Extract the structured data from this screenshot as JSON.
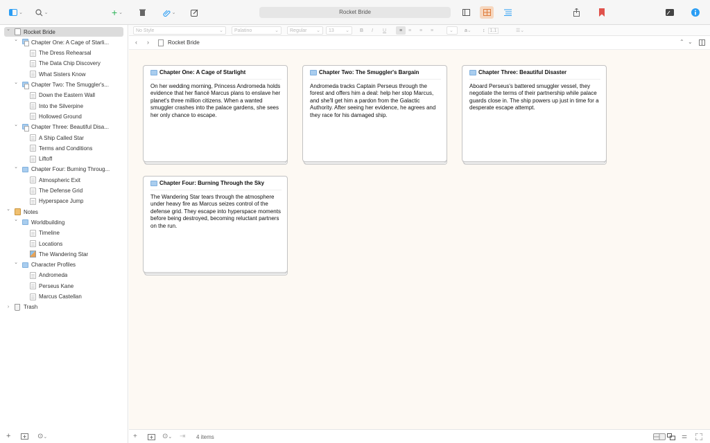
{
  "window": {
    "title": "Rocket Bride"
  },
  "toolbar": {
    "colors": {
      "accent": "#2a9df4",
      "bookmark": "#e0524c",
      "corkboard_active": "#f2c19a"
    }
  },
  "binder": {
    "items": [
      {
        "label": "Rocket Bride",
        "level": 0,
        "icon": "book-icon",
        "arrow": "down",
        "selected": true
      },
      {
        "label": "Chapter One: A Cage of Starli...",
        "level": 1,
        "icon": "folder-doc-icon",
        "arrow": "down"
      },
      {
        "label": "The Dress Rehearsal",
        "level": 2,
        "icon": "document-icon"
      },
      {
        "label": "The Data Chip Discovery",
        "level": 2,
        "icon": "document-icon"
      },
      {
        "label": "What Sisters Know",
        "level": 2,
        "icon": "document-icon"
      },
      {
        "label": "Chapter Two: The Smuggler's...",
        "level": 1,
        "icon": "folder-doc-icon",
        "arrow": "down"
      },
      {
        "label": "Down the Eastern Wall",
        "level": 2,
        "icon": "document-icon"
      },
      {
        "label": "Into the Silverpine",
        "level": 2,
        "icon": "document-icon"
      },
      {
        "label": "Hollowed Ground",
        "level": 2,
        "icon": "document-icon"
      },
      {
        "label": "Chapter Three: Beautiful Disa...",
        "level": 1,
        "icon": "folder-doc-icon",
        "arrow": "down"
      },
      {
        "label": "A Ship Called Star",
        "level": 2,
        "icon": "document-icon"
      },
      {
        "label": "Terms and Conditions",
        "level": 2,
        "icon": "document-icon"
      },
      {
        "label": "Liftoff",
        "level": 2,
        "icon": "document-icon"
      },
      {
        "label": "Chapter Four: Burning Throug...",
        "level": 1,
        "icon": "folder-icon",
        "arrow": "down"
      },
      {
        "label": "Atmospheric Exit",
        "level": 2,
        "icon": "document-icon"
      },
      {
        "label": "The Defense Grid",
        "level": 2,
        "icon": "document-icon"
      },
      {
        "label": "Hyperspace Jump",
        "level": 2,
        "icon": "document-icon"
      },
      {
        "label": "Notes",
        "level": 0,
        "icon": "notes-icon",
        "arrow": "down"
      },
      {
        "label": "Worldbuilding",
        "level": 1,
        "icon": "folder-icon",
        "arrow": "down"
      },
      {
        "label": "Timeline",
        "level": 2,
        "icon": "document-icon"
      },
      {
        "label": "Locations",
        "level": 2,
        "icon": "document-icon"
      },
      {
        "label": "The Wandering Star",
        "level": 2,
        "icon": "image-icon"
      },
      {
        "label": "Character Profiles",
        "level": 1,
        "icon": "folder-icon",
        "arrow": "down"
      },
      {
        "label": "Andromeda",
        "level": 2,
        "icon": "document-icon"
      },
      {
        "label": "Perseus Kane",
        "level": 2,
        "icon": "document-icon"
      },
      {
        "label": "Marcus Castellan",
        "level": 2,
        "icon": "document-icon"
      },
      {
        "label": "Trash",
        "level": 0,
        "icon": "trash-icon",
        "arrow": "right"
      }
    ]
  },
  "formatbar": {
    "style": "No Style",
    "font": "Palatino",
    "weight": "Regular",
    "size": "13",
    "line_spacing": "1.1"
  },
  "header": {
    "title": "Rocket Bride"
  },
  "corkboard": {
    "cards": [
      {
        "title": "Chapter One: A Cage of Starlight",
        "synopsis": "On her wedding morning, Princess Andromeda holds evidence that her fiancé Marcus plans to enslave her planet's three million citizens. When a wanted smuggler crashes into the palace gardens, she sees her only chance to escape."
      },
      {
        "title": "Chapter Two: The Smuggler's Bargain",
        "synopsis": "Andromeda tracks Captain Perseus through the forest and offers him a deal: help her stop Marcus, and she'll get him a pardon from the Galactic Authority. After seeing her evidence, he agrees and they race for his damaged ship."
      },
      {
        "title": "Chapter Three: Beautiful Disaster",
        "synopsis": "Aboard Perseus's battered smuggler vessel, they negotiate the terms of their partnership while palace guards close in. The ship powers up just in time for a desperate escape attempt."
      },
      {
        "title": "Chapter Four: Burning Through the Sky",
        "synopsis": "The Wandering Star tears through the atmosphere under heavy fire as Marcus seizes control of the defense grid. They escape into hyperspace moments before being destroyed, becoming reluctant partners on the run."
      }
    ]
  },
  "footer": {
    "count": "4 items"
  }
}
